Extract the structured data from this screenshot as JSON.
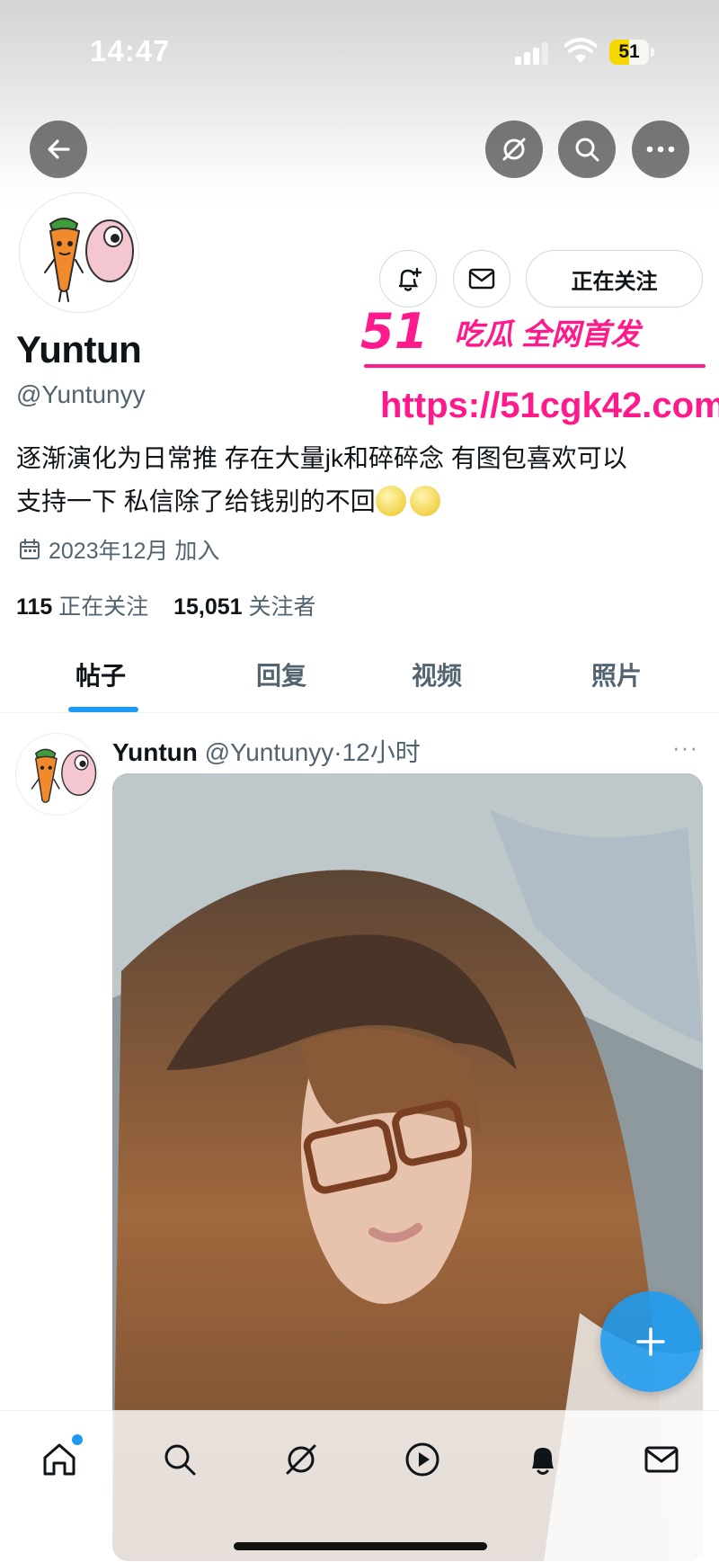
{
  "status_bar": {
    "time": "14:47",
    "battery": "51",
    "battery_level": 0.51
  },
  "profile": {
    "name": "Yuntun",
    "handle": "@Yuntunyy",
    "bio_line1": "逐渐演化为日常推 存在大量jk和碎碎念 有图包喜欢可以",
    "bio_line2": "支持一下 私信除了给钱别的不回",
    "joined": "2023年12月 加入",
    "following_count": "115",
    "following_label": "正在关注",
    "followers_count": "15,051",
    "followers_label": "关注者",
    "follow_button": "正在关注"
  },
  "tabs": [
    {
      "label": "帖子",
      "active": true
    },
    {
      "label": "回复",
      "active": false
    },
    {
      "label": "视频",
      "active": false
    },
    {
      "label": "照片",
      "active": false
    }
  ],
  "post": {
    "author": "Yuntun",
    "handle_time": "@Yuntunyy·12小时",
    "more": "···"
  },
  "watermark": {
    "title": "吃瓜 全网首发",
    "brand_number": "51",
    "url": "https://51cgk42.com"
  },
  "icons": {
    "back": "arrow-left-icon",
    "grok": "grok-icon",
    "search": "search-icon",
    "more": "more-icon",
    "notify": "bell-plus-icon",
    "message": "envelope-icon",
    "calendar": "calendar-icon",
    "compose": "plus-icon",
    "nav": [
      "home-icon",
      "search-icon",
      "grok-icon",
      "play-icon",
      "bell-icon",
      "envelope-icon"
    ]
  },
  "colors": {
    "accent": "#1d9bf0",
    "text": "#0f1419",
    "muted": "#536471",
    "watermark": "#ff1a8c"
  }
}
